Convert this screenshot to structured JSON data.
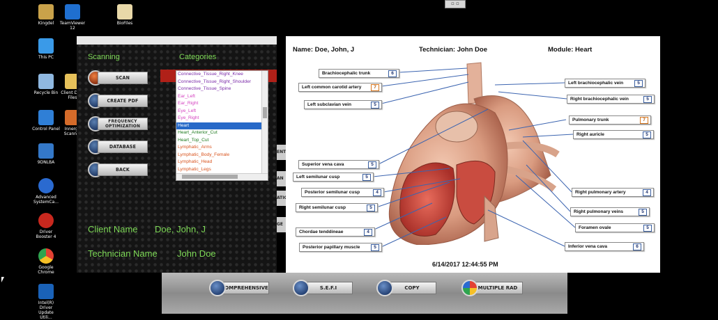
{
  "desktop_icons": [
    {
      "label": "Kingdel",
      "color": "#c9a24a"
    },
    {
      "label": "TeamViewer 12",
      "color": "#1f6fd0"
    },
    {
      "label": "BioFiles",
      "color": "#e8d8a8"
    },
    {
      "label": "This PC",
      "color": "#3a9ae8"
    },
    {
      "label": "Recycle Bin",
      "color": "#8fb8e0"
    },
    {
      "label": "Client Data Files",
      "color": "#e6c15a"
    },
    {
      "label": "Control Panel",
      "color": "#2f7fd6"
    },
    {
      "label": "Innergy Scanner",
      "color": "#d46b2a"
    },
    {
      "label": "9DNLBA",
      "color": "#3478c8"
    },
    {
      "label": "Advanced SystemCa...",
      "color": "#2a6ad0"
    },
    {
      "label": "Driver Booster 4",
      "color": "#c8281e"
    },
    {
      "label": "Google Chrome",
      "color": "#e34133"
    },
    {
      "label": "Intel(R) Driver Update Utili...",
      "color": "#1a62b8"
    }
  ],
  "scanning": {
    "heading": "Scanning",
    "buttons": {
      "scan": "SCAN",
      "create_pdf": "CREATE PDF",
      "freq_line1": "FREQUENCY",
      "freq_line2": "OPTIMIZATION",
      "database": "DATABASE",
      "back": "BACK"
    }
  },
  "categories": {
    "heading": "Categories",
    "items": [
      {
        "label": "Connective_Tissue_Right_Knee",
        "color": "#7a2aa8"
      },
      {
        "label": "Connective_Tissue_Right_Shoulder",
        "color": "#7a2aa8"
      },
      {
        "label": "Connective_Tissue_Spine",
        "color": "#7a2aa8"
      },
      {
        "label": "Ear_Left",
        "color": "#d43fbf"
      },
      {
        "label": "Ear_Right",
        "color": "#d43fbf"
      },
      {
        "label": "Eye_Left",
        "color": "#d43fbf"
      },
      {
        "label": "Eye_Right",
        "color": "#d43fbf"
      },
      {
        "label": "Heart",
        "color": "#ffffff"
      },
      {
        "label": "Heart_Anterior_Cut",
        "color": "#1f7a1f"
      },
      {
        "label": "Heart_Top_Cut",
        "color": "#1f7a1f"
      },
      {
        "label": "Lymphatic_Arms",
        "color": "#d9541e"
      },
      {
        "label": "Lymphatic_Body_Female",
        "color": "#d9541e"
      },
      {
        "label": "Lymphatic_Head",
        "color": "#d9541e"
      },
      {
        "label": "Lymphatic_Legs",
        "color": "#d9541e"
      }
    ],
    "selected": "Heart"
  },
  "client": {
    "name_label": "Client Name",
    "name_value": "Doe, John, J",
    "tech_label": "Technician Name",
    "tech_value": "John Doe"
  },
  "side_fragments": [
    "ENT",
    "AN",
    "ATIO",
    "GE"
  ],
  "report": {
    "name_line": "Name:  Doe, John, J",
    "tech_line": "Technician:  John Doe",
    "module_line": "Module:  Heart",
    "datetime": "6/14/2017 12:44:55 PM",
    "labels": [
      {
        "text": "Brachiocephalic trunk",
        "num": "6",
        "orange": false
      },
      {
        "text": "Left common carotid artery",
        "num": "7",
        "orange": true
      },
      {
        "text": "Left subclavian vein",
        "num": "5",
        "orange": false
      },
      {
        "text": "Superior vena cava",
        "num": "5",
        "orange": false
      },
      {
        "text": "Left semilunar cusp",
        "num": "5",
        "orange": false
      },
      {
        "text": "Posterior semilunar cusp",
        "num": "4",
        "orange": false
      },
      {
        "text": "Right semilunar cusp",
        "num": "5",
        "orange": false
      },
      {
        "text": "Chordae tenddineae",
        "num": "4",
        "orange": false
      },
      {
        "text": "Posterior papillary muscle",
        "num": "5",
        "orange": false
      },
      {
        "text": "Left brachiocephalic vein",
        "num": "5",
        "orange": false
      },
      {
        "text": "Right brachiocephalic vein",
        "num": "5",
        "orange": false
      },
      {
        "text": "Pulmonary trunk",
        "num": "7",
        "orange": true
      },
      {
        "text": "Right auricle",
        "num": "5",
        "orange": false
      },
      {
        "text": "Right pulmonary artery",
        "num": "4",
        "orange": false
      },
      {
        "text": "Right pulmonary veins",
        "num": "5",
        "orange": false
      },
      {
        "text": "Foramen ovale",
        "num": "5",
        "orange": false
      },
      {
        "text": "Inferior vena cava",
        "num": "6",
        "orange": false
      }
    ]
  },
  "bottom_buttons": {
    "comprehensive": "COMPREHENSIVE",
    "sefi": "S.E.F.I",
    "copy": "COPY",
    "multiple_rad": "MULTIPLE RAD"
  }
}
